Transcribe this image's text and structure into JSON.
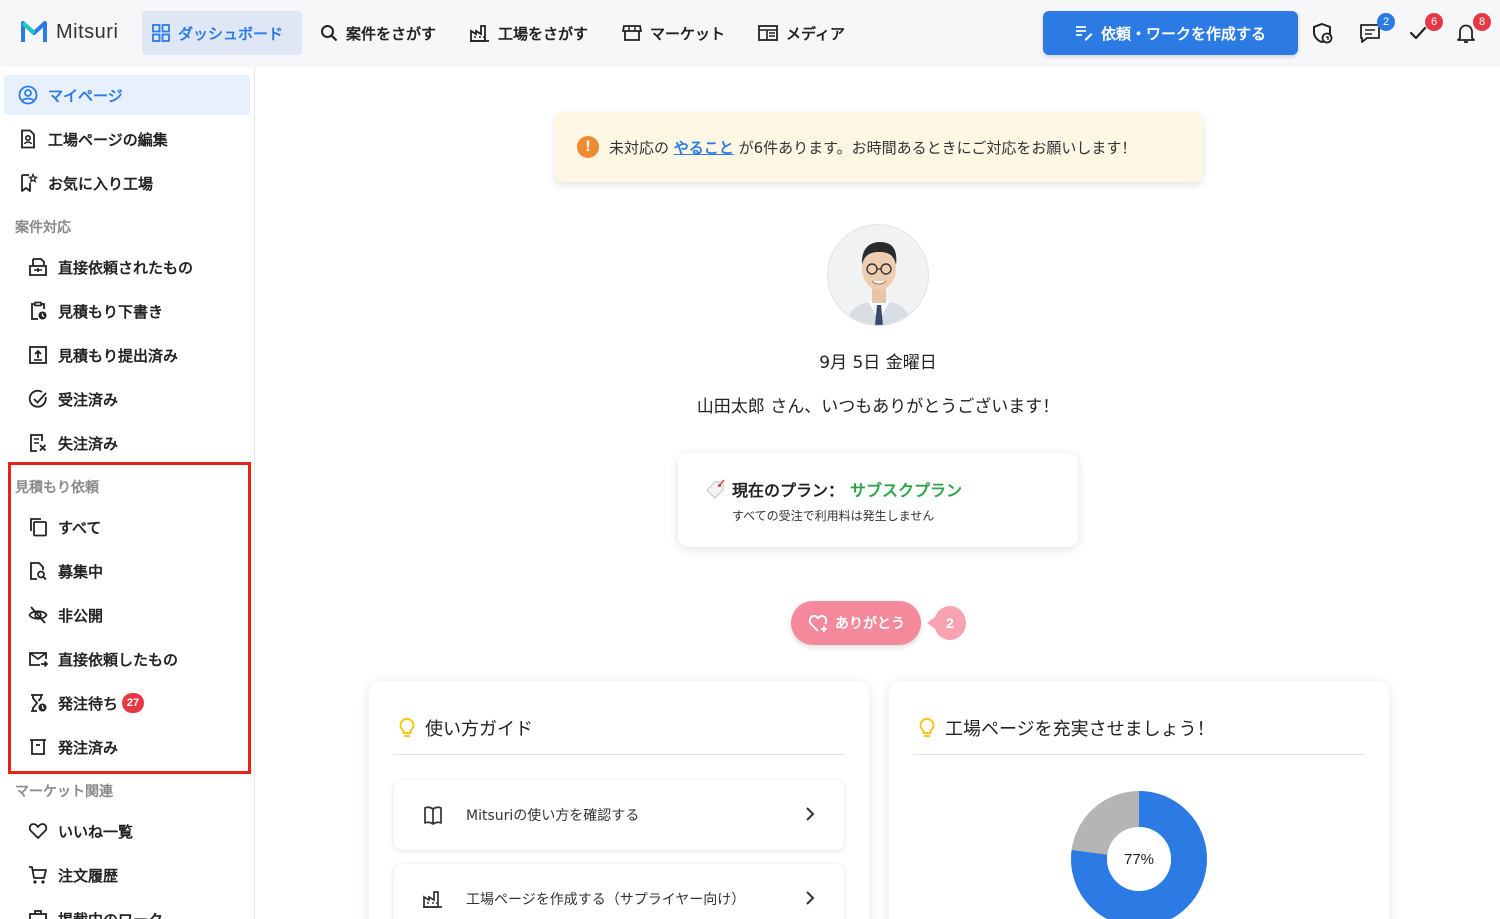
{
  "app": {
    "name": "Mitsuri"
  },
  "colors": {
    "accent": "#2c7be5",
    "badge_red": "#e63946",
    "success": "#2ea34a",
    "highlight": "#e8221b",
    "thanks_pink": "#f4899c"
  },
  "topnav": {
    "items": [
      {
        "label": "ダッシュボード",
        "icon": "grid-icon",
        "active": true
      },
      {
        "label": "案件をさがす",
        "icon": "search-icon"
      },
      {
        "label": "工場をさがす",
        "icon": "factory-icon"
      },
      {
        "label": "マーケット",
        "icon": "store-icon"
      },
      {
        "label": "メディア",
        "icon": "media-icon"
      }
    ],
    "cta_label": "依頼・ワークを作成する",
    "icons": {
      "shield": "shield-icon",
      "messages": {
        "icon": "chat-icon",
        "badge": "2"
      },
      "tasks": {
        "icon": "check-icon",
        "badge": "6"
      },
      "notifications": {
        "icon": "bell-icon",
        "badge": "8"
      }
    }
  },
  "sidebar": {
    "top_items": [
      {
        "label": "マイページ",
        "icon": "user-circle-icon",
        "active": true
      },
      {
        "label": "工場ページの編集",
        "icon": "page-edit-icon"
      },
      {
        "label": "お気に入り工場",
        "icon": "bookmark-icon"
      }
    ],
    "sections": [
      {
        "title": "案件対応",
        "items": [
          {
            "label": "直接依頼されたもの",
            "icon": "inbox-direct-icon"
          },
          {
            "label": "見積もり下書き",
            "icon": "clipboard-clock-icon"
          },
          {
            "label": "見積もり提出済み",
            "icon": "upload-box-icon"
          },
          {
            "label": "受注済み",
            "icon": "check-circle-icon"
          },
          {
            "label": "失注済み",
            "icon": "doc-x-icon"
          }
        ]
      },
      {
        "title": "見積もり依頼",
        "items": [
          {
            "label": "すべて",
            "icon": "copy-icon"
          },
          {
            "label": "募集中",
            "icon": "doc-search-icon"
          },
          {
            "label": "非公開",
            "icon": "eye-off-icon"
          },
          {
            "label": "直接依頼したもの",
            "icon": "mail-send-icon"
          },
          {
            "label": "発注待ち",
            "icon": "hourglass-icon",
            "badge": "27"
          },
          {
            "label": "発注済み",
            "icon": "box-icon"
          }
        ]
      },
      {
        "title": "マーケット関連",
        "items": [
          {
            "label": "いいね一覧",
            "icon": "heart-icon"
          },
          {
            "label": "注文履歴",
            "icon": "cart-icon"
          },
          {
            "label": "掲載中のワーク",
            "icon": "briefcase-icon"
          }
        ]
      }
    ]
  },
  "notice": {
    "prefix": "未対応の",
    "link": "やること",
    "suffix": "が6件あります。お時間あるときにご対応をお願いします！"
  },
  "profile": {
    "date": "9月 5日 金曜日",
    "greeting": "山田太郎 さん、いつもありがとうございます！"
  },
  "plan": {
    "label": "現在のプラン：",
    "name": "サブスクプラン",
    "description": "すべての受注で利用料は発生しません"
  },
  "thanks": {
    "label": "ありがとう",
    "count": "2"
  },
  "guide_card": {
    "title": "使い方ガイド",
    "rows": [
      {
        "label": "Mitsuriの使い方を確認する",
        "icon": "book-icon"
      },
      {
        "label": "工場ページを作成する（サプライヤー向け）",
        "icon": "factory-icon"
      }
    ]
  },
  "profile_card": {
    "title": "工場ページを充実させましょう！",
    "completion_percent": 77,
    "completion_label": "77%"
  }
}
